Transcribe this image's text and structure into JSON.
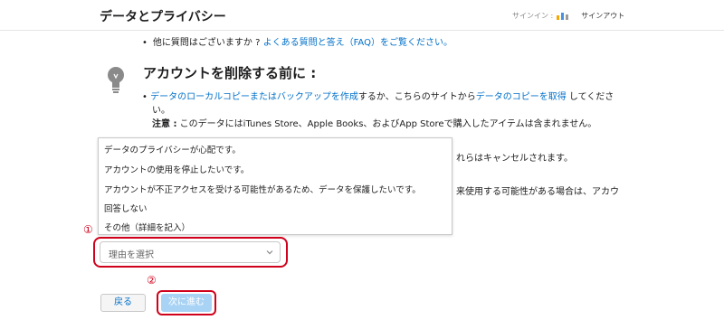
{
  "header": {
    "title": "データとプライバシー",
    "signin_label": "サインイン :",
    "signout_label": "サインアウト"
  },
  "faq": {
    "prefix": "他に質問はございますか ?",
    "link": "よくある質問と答え（FAQ）をご覧ください。"
  },
  "section": {
    "heading": "アカウントを削除する前に :",
    "bullet1_link1": "データのローカルコピーまたはバックアップを作成",
    "bullet1_mid": "するか、こちらのサイトから",
    "bullet1_link2": "データのコピーを取得",
    "bullet1_tail": " してくださ",
    "bullet1_wrap": "い。",
    "note_label": "注意 :",
    "note_text": " このデータにはiTunes Store、Apple Books、およびApp Storeで購入したアイテムは含まれません。",
    "partial_right_1": "れらはキャンセルされます。",
    "partial_right_2": "来使用する可能性がある場合は、アカウ"
  },
  "dropdown": {
    "options": [
      "データのプライバシーが心配です。",
      "アカウントの使用を停止したいです。",
      "アカウントが不正アクセスを受ける可能性があるため、データを保護したいです。",
      "回答しない",
      "その他（詳細を記入）"
    ]
  },
  "select": {
    "placeholder": "理由を選択"
  },
  "markers": {
    "step1": "①",
    "step2": "②"
  },
  "buttons": {
    "back": "戻る",
    "next": "次に進む"
  },
  "colors": {
    "link": "#0070c9",
    "highlight": "#d0021b",
    "next_button": "#a9d3f5"
  }
}
